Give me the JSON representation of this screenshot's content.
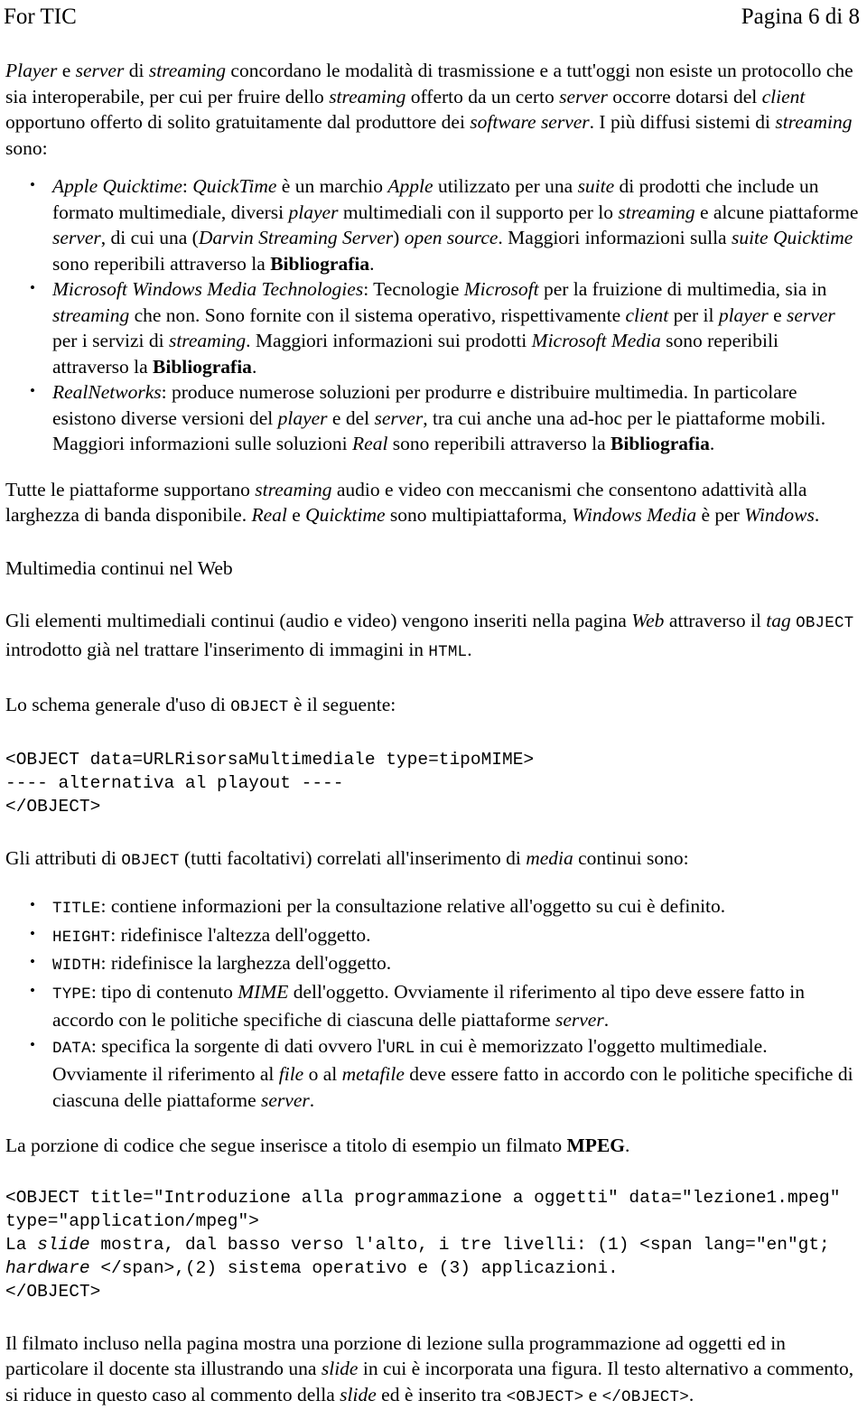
{
  "header": {
    "left": "For TIC",
    "right": "Pagina 6 di 8"
  },
  "intro": {
    "seg1": "Player",
    "seg2": " e ",
    "seg3": "server",
    "seg4": " di ",
    "seg5": "streaming",
    "seg6": " concordano le modalità di trasmissione e a tutt'oggi non esiste un protocollo che sia interoperabile, per cui per fruire dello ",
    "seg7": "streaming",
    "seg8": " offerto da un certo ",
    "seg9": "server",
    "seg10": " occorre dotarsi del ",
    "seg11": "client",
    "seg12": " opportuno offerto di solito gratuitamente dal produttore dei ",
    "seg13": "software server",
    "seg14": ". I più diffusi sistemi di ",
    "seg15": "streaming",
    "seg16": " sono:"
  },
  "platforms": [
    {
      "name": "Apple Quicktime",
      "colon": ": ",
      "t1": "QuickTime",
      "t2": " è un marchio ",
      "t3": "Apple",
      "t4": " utilizzato per una ",
      "t5": "suite",
      "t6": " di prodotti che include un formato multimediale, diversi ",
      "t7": "player",
      "t8": " multimediali con il supporto per lo ",
      "t9": "streaming",
      "t10": " e alcune piattaforme ",
      "t11": "server",
      "t12": ", di cui una (",
      "t13": "Darvin Streaming Server",
      "t14": ") ",
      "t15": "open source",
      "t16": ". Maggiori informazioni sulla ",
      "t17": "suite Quicktime",
      "t18": " sono reperibili attraverso la ",
      "t19": "Bibliografia",
      "t20": "."
    },
    {
      "name": "Microsoft Windows Media Technologies",
      "colon": ": ",
      "t1": "Tecnologie ",
      "t2": "Microsoft",
      "t3": " per la fruizione di multimedia, sia in ",
      "t4": "streaming",
      "t5": " che non. Sono fornite con il sistema operativo, rispettivamente ",
      "t6": "client",
      "t7": " per il ",
      "t8": "player",
      "t9": " e ",
      "t10": "server",
      "t11": " per i servizi di ",
      "t12": "streaming",
      "t13": ". Maggiori informazioni sui prodotti ",
      "t14": "Microsoft Media",
      "t15": " sono reperibili attraverso la ",
      "t16": "Bibliografia",
      "t17": "."
    },
    {
      "name": "RealNetworks",
      "colon": ": ",
      "t1": "produce numerose soluzioni per produrre e distribuire multimedia. In particolare esistono diverse versioni del ",
      "t2": "player",
      "t3": " e del ",
      "t4": "server",
      "t5": ", tra cui anche una ad-hoc per le piattaforme mobili. Maggiori informazioni sulle soluzioni ",
      "t6": "Real",
      "t7": " sono reperibili attraverso la ",
      "t8": "Bibliografia",
      "t9": "."
    }
  ],
  "summary": {
    "s1": "Tutte le piattaforme supportano ",
    "s2": "streaming",
    "s3": " audio e video con meccanismi che consentono adattività alla larghezza di banda disponibile. ",
    "s4": "Real",
    "s5": " e ",
    "s6": "Quicktime",
    "s7": " sono multipiattaforma, ",
    "s8": "Windows Media",
    "s9": " è per ",
    "s10": "Windows",
    "s11": "."
  },
  "subhead": "Multimedia continui nel Web",
  "objectIntro": {
    "p1": "Gli elementi multimediali continui (audio e video) vengono inseriti nella pagina ",
    "p2": "Web",
    "p3": " attraverso il ",
    "p4": "tag",
    "p5": " ",
    "p6": "OBJECT",
    "p7": " introdotto già nel trattare l'inserimento di immagini in ",
    "p8": "HTML",
    "p9": "."
  },
  "schemaIntro": {
    "q1": "Lo schema generale d'uso di ",
    "q2": "OBJECT",
    "q3": " è il seguente:"
  },
  "code1": "<OBJECT data=URLRisorsaMultimediale type=tipoMIME>\n---- alternativa al playout ----\n</OBJECT>",
  "attrsIntro": {
    "a1": "Gli attributi di ",
    "a2": "OBJECT",
    "a3": " (tutti facoltativi) correlati all'inserimento di ",
    "a4": "media",
    "a5": " continui sono:"
  },
  "attributes": [
    {
      "name": "TITLE",
      "colon": ": ",
      "t1": "contiene informazioni per la consultazione relative all'oggetto su cui è definito.",
      "t2": "",
      "t3": "",
      "t4": "",
      "t5": "",
      "t6": "",
      "t7": ""
    },
    {
      "name": "HEIGHT",
      "colon": ": ",
      "t1": "ridefinisce l'altezza dell'oggetto.",
      "t2": "",
      "t3": "",
      "t4": "",
      "t5": "",
      "t6": "",
      "t7": ""
    },
    {
      "name": "WIDTH",
      "colon": ": ",
      "t1": "ridefinisce la larghezza dell'oggetto.",
      "t2": "",
      "t3": "",
      "t4": "",
      "t5": "",
      "t6": "",
      "t7": ""
    },
    {
      "name": "TYPE",
      "colon": ": ",
      "t1": "tipo di contenuto ",
      "t2": "MIME",
      "t3": " dell'oggetto. Ovviamente il riferimento al tipo deve essere fatto in accordo con le politiche specifiche di ciascuna delle piattaforme ",
      "t4": "server",
      "t5": ".",
      "t6": "",
      "t7": ""
    },
    {
      "name": "DATA",
      "colon": ": ",
      "t1": "specifica la sorgente di dati ovvero l'",
      "t2": "URL",
      "t3": " in cui è memorizzato l'oggetto multimediale. Ovviamente il riferimento al ",
      "t4": "file",
      "t5": " o al ",
      "t6": "metafile",
      "t7": " deve essere fatto in accordo con le politiche specifiche di ciascuna delle piattaforme ",
      "t8": "server",
      "t9": "."
    }
  ],
  "exampleIntro": {
    "e1": "La porzione di codice che segue inserisce a titolo di esempio un filmato ",
    "e2": "MPEG",
    "e3": "."
  },
  "code2": {
    "l1": "<OBJECT title=\"Introduzione alla programmazione a oggetti\" data=\"lezione1.mpeg\"",
    "l2": "type=\"application/mpeg\">",
    "l3a": "La ",
    "l3b": "slide",
    "l3c": " mostra, dal basso verso l'alto, i tre livelli: (1) <span lang=\"en\"gt;",
    "l4a": "hardware",
    "l4b": " </span>,(2) sistema operativo e (3) applicazioni.",
    "l5": "</OBJECT>"
  },
  "closing": {
    "c1": "Il filmato incluso nella pagina mostra una porzione di lezione sulla programmazione ad oggetti ed in particolare il docente sta illustrando una ",
    "c2": "slide",
    "c3": " in cui è incorporata una figura. Il testo alternativo a commento, si riduce in questo caso al commento della ",
    "c4": "slide",
    "c5": " ed è inserito tra ",
    "c6": "<OBJECT>",
    "c7": " e ",
    "c8": "</OBJECT>",
    "c9": "."
  }
}
